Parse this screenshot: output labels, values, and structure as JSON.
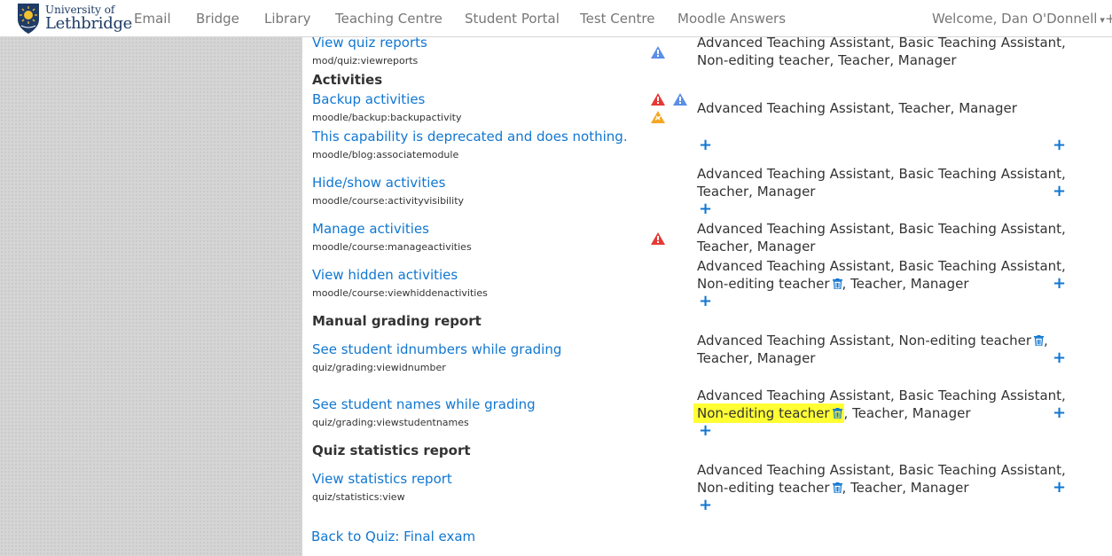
{
  "navbar": {
    "brand_line1": "University of",
    "brand_line2": "Lethbridge",
    "links": [
      "Email",
      "Bridge",
      "Library",
      "Teaching Centre",
      "Student Portal",
      "Test Centre",
      "Moodle Answers"
    ],
    "welcome": "Welcome, Dan O'Donnell",
    "caret": "▾",
    "extra": "+"
  },
  "rows": {
    "view_quiz_reports": {
      "label": "View quiz reports",
      "code": "mod/quiz:viewreports",
      "roles_line1": "Advanced Teaching Assistant, Basic Teaching Assistant,",
      "roles_line2": "Non-editing teacher, Teacher, Manager"
    },
    "activities_head": "Activities",
    "backup_activities": {
      "label": "Backup activities",
      "code": "moodle/backup:backupactivity",
      "roles_line1": "Advanced Teaching Assistant, Teacher, Manager"
    },
    "deprecated": {
      "label": "This capability is deprecated and does nothing.",
      "code": "moodle/blog:associatemodule"
    },
    "hide_show": {
      "label": "Hide/show activities",
      "code": "moodle/course:activityvisibility",
      "roles_line1": "Advanced Teaching Assistant, Basic Teaching Assistant,",
      "roles_line2": "Teacher, Manager"
    },
    "manage_activities": {
      "label": "Manage activities",
      "code": "moodle/course:manageactivities",
      "roles_line1": "Advanced Teaching Assistant, Basic Teaching Assistant,",
      "roles_line2": "Teacher, Manager"
    },
    "view_hidden": {
      "label": "View hidden activities",
      "code": "moodle/course:viewhiddenactivities",
      "roles_line1": "Advanced Teaching Assistant, Basic Teaching Assistant,",
      "role_net": "Non-editing teacher",
      "roles_rest": ", Teacher, Manager"
    },
    "manual_grading_head": "Manual grading report",
    "see_idnumbers": {
      "label": "See student idnumbers while grading",
      "code": "quiz/grading:viewidnumber",
      "roles_prefix": "Advanced Teaching Assistant, ",
      "role_net": "Non-editing teacher",
      "roles_comma": ",",
      "roles_line2": "Teacher, Manager"
    },
    "see_names": {
      "label": "See student names while grading",
      "code": "quiz/grading:viewstudentnames",
      "roles_line1": "Advanced Teaching Assistant, Basic Teaching Assistant,",
      "role_net": "Non-editing teacher",
      "roles_rest": ", Teacher, Manager"
    },
    "quiz_stats_head": "Quiz statistics report",
    "view_statistics": {
      "label": "View statistics report",
      "code": "quiz/statistics:view",
      "roles_line1": "Advanced Teaching Assistant, Basic Teaching Assistant,",
      "role_net": "Non-editing teacher",
      "roles_rest": ", Teacher, Manager"
    }
  },
  "plus_symbol": "+",
  "back_link": "Back to Quiz: Final exam",
  "colors": {
    "link": "#1177d1",
    "highlight": "#ffff33",
    "risk_red": "#e53935",
    "risk_orange": "#f5a623",
    "risk_blue": "#5b8ee6",
    "brand_navy": "#1f3b66",
    "brand_gold": "#f2c12e"
  },
  "icons": [
    "university-shield-icon",
    "user-caret-icon",
    "risk-config-icon",
    "risk-dataloss-icon",
    "risk-xss-icon",
    "trash-icon",
    "plus-icon"
  ]
}
